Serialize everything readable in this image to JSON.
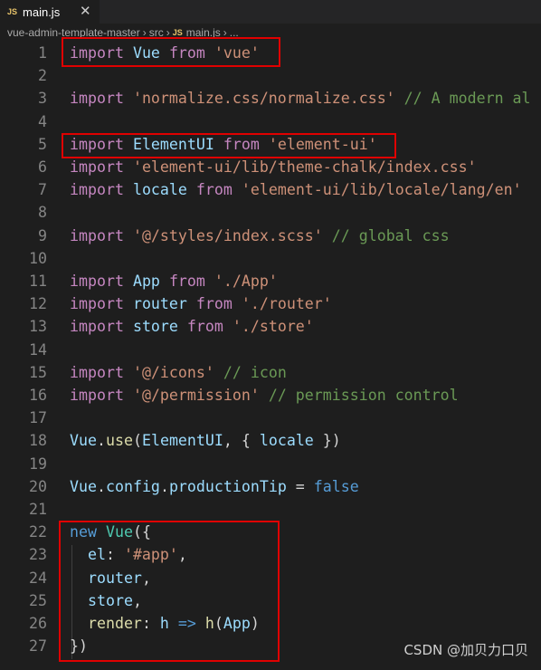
{
  "tab": {
    "icon": "js-icon",
    "badge": "JS",
    "title": "main.js",
    "close": "✕"
  },
  "breadcrumb": [
    "vue-admin-template-master",
    "src",
    "main.js",
    "..."
  ],
  "breadcrumb_badge": "JS",
  "lines": [
    {
      "n": "1",
      "tokens": [
        [
          "kwc",
          "import"
        ],
        [
          "punc",
          " "
        ],
        [
          "var",
          "Vue"
        ],
        [
          "punc",
          " "
        ],
        [
          "kwc",
          "from"
        ],
        [
          "punc",
          " "
        ],
        [
          "str",
          "'vue'"
        ]
      ]
    },
    {
      "n": "2",
      "tokens": []
    },
    {
      "n": "3",
      "tokens": [
        [
          "kwc",
          "import"
        ],
        [
          "punc",
          " "
        ],
        [
          "str",
          "'normalize.css/normalize.css'"
        ],
        [
          "punc",
          " "
        ],
        [
          "com",
          "// A modern al"
        ]
      ]
    },
    {
      "n": "4",
      "tokens": []
    },
    {
      "n": "5",
      "tokens": [
        [
          "kwc",
          "import"
        ],
        [
          "punc",
          " "
        ],
        [
          "var",
          "ElementUI"
        ],
        [
          "punc",
          " "
        ],
        [
          "kwc",
          "from"
        ],
        [
          "punc",
          " "
        ],
        [
          "str",
          "'element-ui'"
        ]
      ]
    },
    {
      "n": "6",
      "tokens": [
        [
          "kwc",
          "import"
        ],
        [
          "punc",
          " "
        ],
        [
          "str",
          "'element-ui/lib/theme-chalk/index.css'"
        ]
      ]
    },
    {
      "n": "7",
      "tokens": [
        [
          "kwc",
          "import"
        ],
        [
          "punc",
          " "
        ],
        [
          "var",
          "locale"
        ],
        [
          "punc",
          " "
        ],
        [
          "kwc",
          "from"
        ],
        [
          "punc",
          " "
        ],
        [
          "str",
          "'element-ui/lib/locale/lang/en'"
        ]
      ]
    },
    {
      "n": "8",
      "tokens": []
    },
    {
      "n": "9",
      "tokens": [
        [
          "kwc",
          "import"
        ],
        [
          "punc",
          " "
        ],
        [
          "str",
          "'@/styles/index.scss'"
        ],
        [
          "punc",
          " "
        ],
        [
          "com",
          "// global css"
        ]
      ]
    },
    {
      "n": "10",
      "tokens": []
    },
    {
      "n": "11",
      "tokens": [
        [
          "kwc",
          "import"
        ],
        [
          "punc",
          " "
        ],
        [
          "var",
          "App"
        ],
        [
          "punc",
          " "
        ],
        [
          "kwc",
          "from"
        ],
        [
          "punc",
          " "
        ],
        [
          "str",
          "'./App'"
        ]
      ]
    },
    {
      "n": "12",
      "tokens": [
        [
          "kwc",
          "import"
        ],
        [
          "punc",
          " "
        ],
        [
          "var",
          "router"
        ],
        [
          "punc",
          " "
        ],
        [
          "kwc",
          "from"
        ],
        [
          "punc",
          " "
        ],
        [
          "str",
          "'./router'"
        ]
      ]
    },
    {
      "n": "13",
      "tokens": [
        [
          "kwc",
          "import"
        ],
        [
          "punc",
          " "
        ],
        [
          "var",
          "store"
        ],
        [
          "punc",
          " "
        ],
        [
          "kwc",
          "from"
        ],
        [
          "punc",
          " "
        ],
        [
          "str",
          "'./store'"
        ]
      ]
    },
    {
      "n": "14",
      "tokens": []
    },
    {
      "n": "15",
      "tokens": [
        [
          "kwc",
          "import"
        ],
        [
          "punc",
          " "
        ],
        [
          "str",
          "'@/icons'"
        ],
        [
          "punc",
          " "
        ],
        [
          "com",
          "// icon"
        ]
      ]
    },
    {
      "n": "16",
      "tokens": [
        [
          "kwc",
          "import"
        ],
        [
          "punc",
          " "
        ],
        [
          "str",
          "'@/permission'"
        ],
        [
          "punc",
          " "
        ],
        [
          "com",
          "// permission control"
        ]
      ]
    },
    {
      "n": "17",
      "tokens": []
    },
    {
      "n": "18",
      "tokens": [
        [
          "var",
          "Vue"
        ],
        [
          "punc",
          "."
        ],
        [
          "fn",
          "use"
        ],
        [
          "punc",
          "("
        ],
        [
          "var",
          "ElementUI"
        ],
        [
          "punc",
          ", { "
        ],
        [
          "var",
          "locale"
        ],
        [
          "punc",
          " })"
        ]
      ]
    },
    {
      "n": "19",
      "tokens": []
    },
    {
      "n": "20",
      "tokens": [
        [
          "var",
          "Vue"
        ],
        [
          "punc",
          "."
        ],
        [
          "var",
          "config"
        ],
        [
          "punc",
          "."
        ],
        [
          "var",
          "productionTip"
        ],
        [
          "punc",
          " = "
        ],
        [
          "kw",
          "false"
        ]
      ]
    },
    {
      "n": "21",
      "tokens": []
    },
    {
      "n": "22",
      "tokens": [
        [
          "kw",
          "new"
        ],
        [
          "punc",
          " "
        ],
        [
          "cls",
          "Vue"
        ],
        [
          "punc",
          "({"
        ]
      ]
    },
    {
      "n": "23",
      "tokens": [
        [
          "punc",
          "  "
        ],
        [
          "var",
          "el"
        ],
        [
          "punc",
          ": "
        ],
        [
          "str",
          "'#app'"
        ],
        [
          "punc",
          ","
        ]
      ]
    },
    {
      "n": "24",
      "tokens": [
        [
          "punc",
          "  "
        ],
        [
          "var",
          "router"
        ],
        [
          "punc",
          ","
        ]
      ]
    },
    {
      "n": "25",
      "tokens": [
        [
          "punc",
          "  "
        ],
        [
          "var",
          "store"
        ],
        [
          "punc",
          ","
        ]
      ]
    },
    {
      "n": "26",
      "tokens": [
        [
          "punc",
          "  "
        ],
        [
          "fn",
          "render"
        ],
        [
          "punc",
          ": "
        ],
        [
          "var",
          "h"
        ],
        [
          "punc",
          " "
        ],
        [
          "kw",
          "=>"
        ],
        [
          "punc",
          " "
        ],
        [
          "fn",
          "h"
        ],
        [
          "punc",
          "("
        ],
        [
          "var",
          "App"
        ],
        [
          "punc",
          ")"
        ]
      ]
    },
    {
      "n": "27",
      "tokens": [
        [
          "punc",
          "})"
        ]
      ]
    }
  ],
  "watermark": "CSDN @加贝力口贝"
}
